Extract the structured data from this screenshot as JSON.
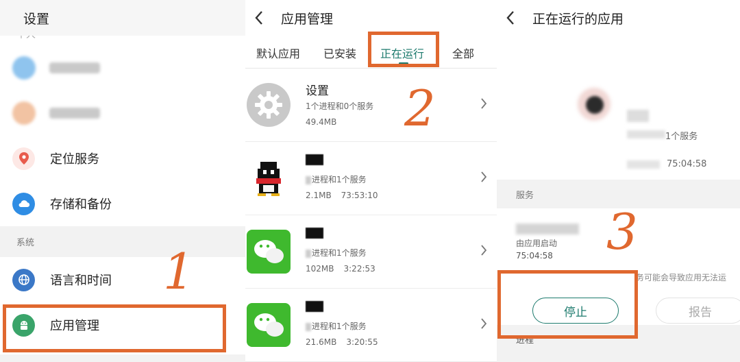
{
  "panel1": {
    "title": "设置",
    "cut_label": "个人",
    "items": [
      {
        "label": "",
        "icon": "blurred-app-icon",
        "color": "#8fc4ee"
      },
      {
        "label": "",
        "icon": "blurred-app-icon",
        "color": "#f2c3a3"
      },
      {
        "label": "定位服务",
        "icon": "location-pin-icon",
        "color": "#e85b4c"
      },
      {
        "label": "存储和备份",
        "icon": "cloud-icon",
        "color": "#2f8de4"
      }
    ],
    "section_system": "系统",
    "system_items": [
      {
        "label": "语言和时间",
        "icon": "globe-icon",
        "color": "#3b78c7"
      },
      {
        "label": "应用管理",
        "icon": "android-icon",
        "color": "#3aa46a"
      }
    ]
  },
  "panel2": {
    "title": "应用管理",
    "tabs": [
      "默认应用",
      "已安装",
      "正在运行",
      "全部"
    ],
    "active_tab": "正在运行",
    "apps": [
      {
        "name": "设置",
        "sub": "1个进程和0个服务",
        "size": "49.4MB",
        "time": "",
        "icon": "gear-icon"
      },
      {
        "name": "",
        "sub": "进程和1个服务",
        "size": "2.1MB",
        "time": "73:53:10",
        "icon": "qq-penguin-icon"
      },
      {
        "name": "",
        "sub": "进程和1个服务",
        "size": "102MB",
        "time": "3:22:53",
        "icon": "wechat-icon"
      },
      {
        "name": "",
        "sub": "进程和1个服务",
        "size": "21.6MB",
        "time": "3:20:55",
        "icon": "wechat-icon"
      }
    ]
  },
  "panel3": {
    "title": "正在运行的应用",
    "app_services": "1个服务",
    "app_time": "75:04:58",
    "section_services": "服务",
    "svc_line": "由应用启动",
    "svc_time": "75:04:58",
    "warn": "务可能会导致应用无法运",
    "stop_label": "停止",
    "report_label": "报告",
    "section_process": "进程"
  },
  "annotations": {
    "step1": "1",
    "step2": "2",
    "step3": "3",
    "color": "#e0682f"
  },
  "accent_color": "#1c7a6d"
}
